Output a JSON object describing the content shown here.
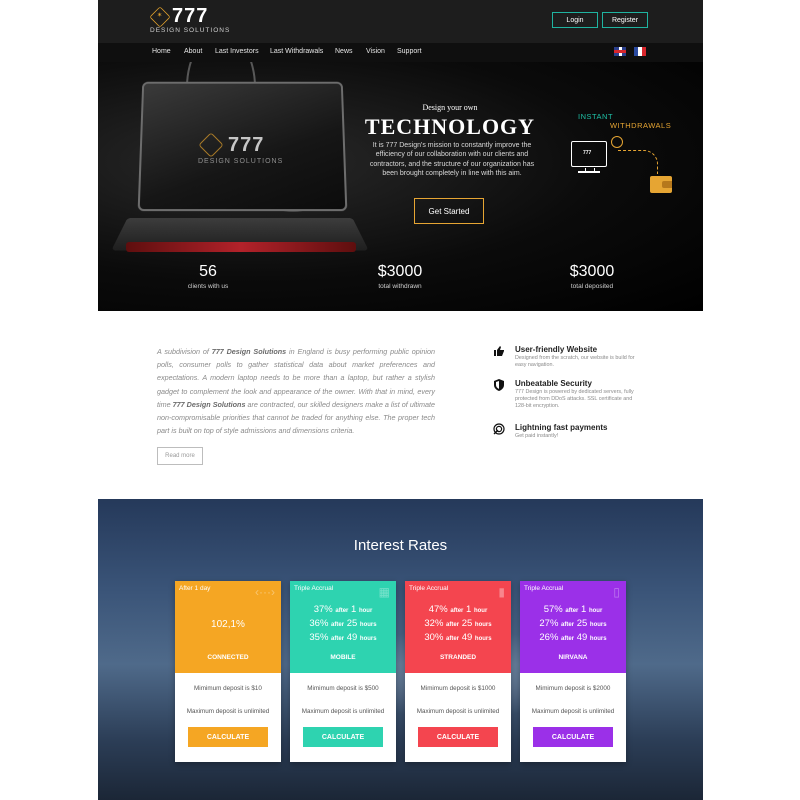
{
  "header": {
    "logo_num": "777",
    "logo_sub": "DESIGN SOLUTIONS",
    "login": "Login",
    "register": "Register"
  },
  "nav": {
    "items": [
      "Home",
      "About",
      "Last Investors",
      "Last Withdrawals",
      "News",
      "Vision",
      "Support"
    ],
    "flags": [
      "uk-flag-icon",
      "france-flag-icon"
    ]
  },
  "hero": {
    "small": "Design your own",
    "title": "TECHNOLOGY",
    "text": "It is 777 Design's mission to constantly improve the efficiency of our collaboration with our clients and contractors, and the structure of our organization has been brought completely in line with this aim.",
    "button": "Get Started",
    "instant": "INSTANT",
    "withdrawals": "WITHDRAWALS",
    "monitor_label": "777",
    "laptop_logo_num": "777",
    "laptop_logo_sub": "DESIGN SOLUTIONS",
    "stats": [
      {
        "value": "56",
        "label": "clients with us"
      },
      {
        "value": "$3000",
        "label": "total withdrawn"
      },
      {
        "value": "$3000",
        "label": "total deposited"
      }
    ]
  },
  "about": {
    "p1": "A subdivision of ",
    "b1": "777 Design Solutions",
    "p2": " in England is busy performing public opinion polls, consumer polls to gather statistical data about market preferences and expectations. A modern laptop needs to be more than a laptop, but rather a stylish gadget to complement the look and appearance of the owner. With that in mind, every time ",
    "b2": "777 Design Solutions",
    "p3": " are contracted, our skilled designers make a list of ultimate non-compromisable priorities that cannot be traded for anything else. The proper tech part is built on top of style admissions and dimensions criteria.",
    "read_more": "Read more"
  },
  "features": [
    {
      "icon": "thumbs-up-icon",
      "title": "User-friendly Website",
      "desc": "Designed from the scratch, our website is build for easy navigation."
    },
    {
      "icon": "shield-icon",
      "title": "Unbeatable Security",
      "desc": "777 Design is powered by dedicated servers, fully protected from DDoS attacks. SSL certificate and 128-bit encryption."
    },
    {
      "icon": "fingerprint-icon",
      "title": "Lightning fast payments",
      "desc": "Get paid instantly!"
    }
  ],
  "rates": {
    "title": "Interest Rates",
    "plans": [
      {
        "label": "After 1 day",
        "icon": "code-icon",
        "color": "#f5a623",
        "main": "102,1%",
        "rates": [],
        "name": "CONNECTED",
        "min": "Mimimum deposit is $10",
        "max": "Maximum deposit is unlimited",
        "button": "CALCULATE"
      },
      {
        "label": "Triple Accrual",
        "icon": "keyboard-icon",
        "color": "#2ed3b0",
        "main": "",
        "rates": [
          {
            "pct": "37%",
            "after": "after",
            "n": "1",
            "unit": "hour"
          },
          {
            "pct": "36%",
            "after": "after",
            "n": "25",
            "unit": "hours"
          },
          {
            "pct": "35%",
            "after": "after",
            "n": "49",
            "unit": "hours"
          }
        ],
        "name": "MOBILE",
        "min": "Mimimum deposit is $500",
        "max": "Maximum deposit is unlimited",
        "button": "CALCULATE"
      },
      {
        "label": "Triple Accrual",
        "icon": "bookmark-icon",
        "color": "#f4454f",
        "main": "",
        "rates": [
          {
            "pct": "47%",
            "after": "after",
            "n": "1",
            "unit": "hour"
          },
          {
            "pct": "32%",
            "after": "after",
            "n": "25",
            "unit": "hours"
          },
          {
            "pct": "30%",
            "after": "after",
            "n": "49",
            "unit": "hours"
          }
        ],
        "name": "STRANDED",
        "min": "Mimimum deposit is $1000",
        "max": "Maximum deposit is unlimited",
        "button": "CALCULATE"
      },
      {
        "label": "Triple Accrual",
        "icon": "document-icon",
        "color": "#9b30e8",
        "main": "",
        "rates": [
          {
            "pct": "57%",
            "after": "after",
            "n": "1",
            "unit": "hour"
          },
          {
            "pct": "27%",
            "after": "after",
            "n": "25",
            "unit": "hours"
          },
          {
            "pct": "26%",
            "after": "after",
            "n": "49",
            "unit": "hours"
          }
        ],
        "name": "NIRVANA",
        "min": "Mimimum deposit is $2000",
        "max": "Maximum deposit is unlimited",
        "button": "CALCULATE"
      }
    ]
  }
}
